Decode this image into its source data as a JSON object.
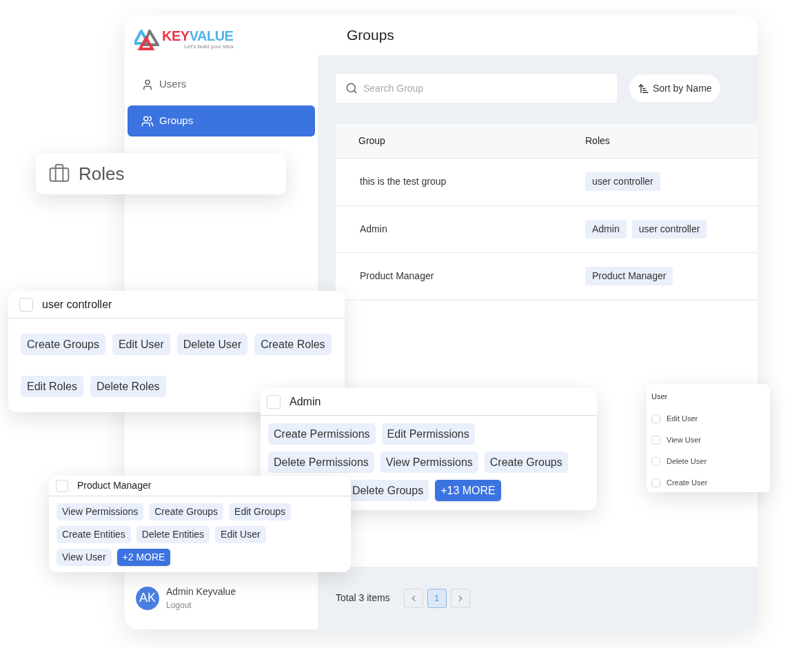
{
  "sidebar": {
    "logo": {
      "brand_first": "KEY",
      "brand_second": "VALUE",
      "tagline": "Let’s build your idea"
    },
    "items": [
      {
        "label": "Users",
        "selected": false
      },
      {
        "label": "Groups",
        "selected": true
      }
    ],
    "user": {
      "initials": "AK",
      "name": "Admin Keyvalue",
      "action": "Logout"
    }
  },
  "header": {
    "title": "Groups"
  },
  "search": {
    "placeholder": "Search Group"
  },
  "sort_button": {
    "label": "Sort by Name"
  },
  "table": {
    "columns": [
      "Group",
      "Roles"
    ],
    "rows": [
      {
        "group": "this is the test group",
        "roles": [
          "user controller"
        ]
      },
      {
        "group": "Admin",
        "roles": [
          "Admin",
          "user controller"
        ]
      },
      {
        "group": "Product Manager",
        "roles": [
          "Product Manager"
        ]
      }
    ]
  },
  "footer": {
    "total": "Total 3 items",
    "pages": [
      {
        "label": "1",
        "selected": true
      }
    ]
  },
  "roles_card": {
    "label": "Roles"
  },
  "role_cards": [
    {
      "title": "user controller",
      "checked": false,
      "rows": [
        [
          {
            "kind": "permission",
            "label": "Create Groups"
          },
          {
            "kind": "permission",
            "label": "Edit User"
          },
          {
            "kind": "permission",
            "label": "Delete User"
          },
          {
            "kind": "permission",
            "label": "Create Roles"
          }
        ],
        [
          {
            "kind": "permission",
            "label": "Edit Roles"
          },
          {
            "kind": "permission",
            "label": "Delete Roles"
          }
        ]
      ]
    },
    {
      "title": "Admin",
      "checked": false,
      "rows": [
        [
          {
            "kind": "permission",
            "label": "Create Permissions"
          },
          {
            "kind": "permission",
            "label": "Edit Permissions"
          }
        ],
        [
          {
            "kind": "permission",
            "label": "Delete Permissions"
          },
          {
            "kind": "permission",
            "label": "View Permissions"
          },
          {
            "kind": "permission",
            "label": "Create Groups"
          }
        ],
        [
          {
            "kind": "permission",
            "label": "Delete Groups"
          },
          {
            "kind": "more",
            "label": "+13 MORE"
          }
        ]
      ]
    },
    {
      "title": "Product Manager",
      "checked": false,
      "rows": [
        [
          {
            "kind": "permission",
            "label": "View Permissions"
          },
          {
            "kind": "permission",
            "label": "Create Groups"
          },
          {
            "kind": "permission",
            "label": "Edit Groups"
          }
        ],
        [
          {
            "kind": "permission",
            "label": "Create Entities"
          },
          {
            "kind": "permission",
            "label": "Delete Entities"
          },
          {
            "kind": "permission",
            "label": "Edit User"
          }
        ],
        [
          {
            "kind": "permission",
            "label": "View User"
          },
          {
            "kind": "more",
            "label": "+2 MORE"
          }
        ]
      ]
    }
  ],
  "user_panel": {
    "title": "User",
    "options": [
      {
        "label": "Edit User",
        "checked": false
      },
      {
        "label": "View User",
        "checked": false
      },
      {
        "label": "Delete User",
        "checked": false
      },
      {
        "label": "Create User",
        "checked": false
      }
    ]
  }
}
